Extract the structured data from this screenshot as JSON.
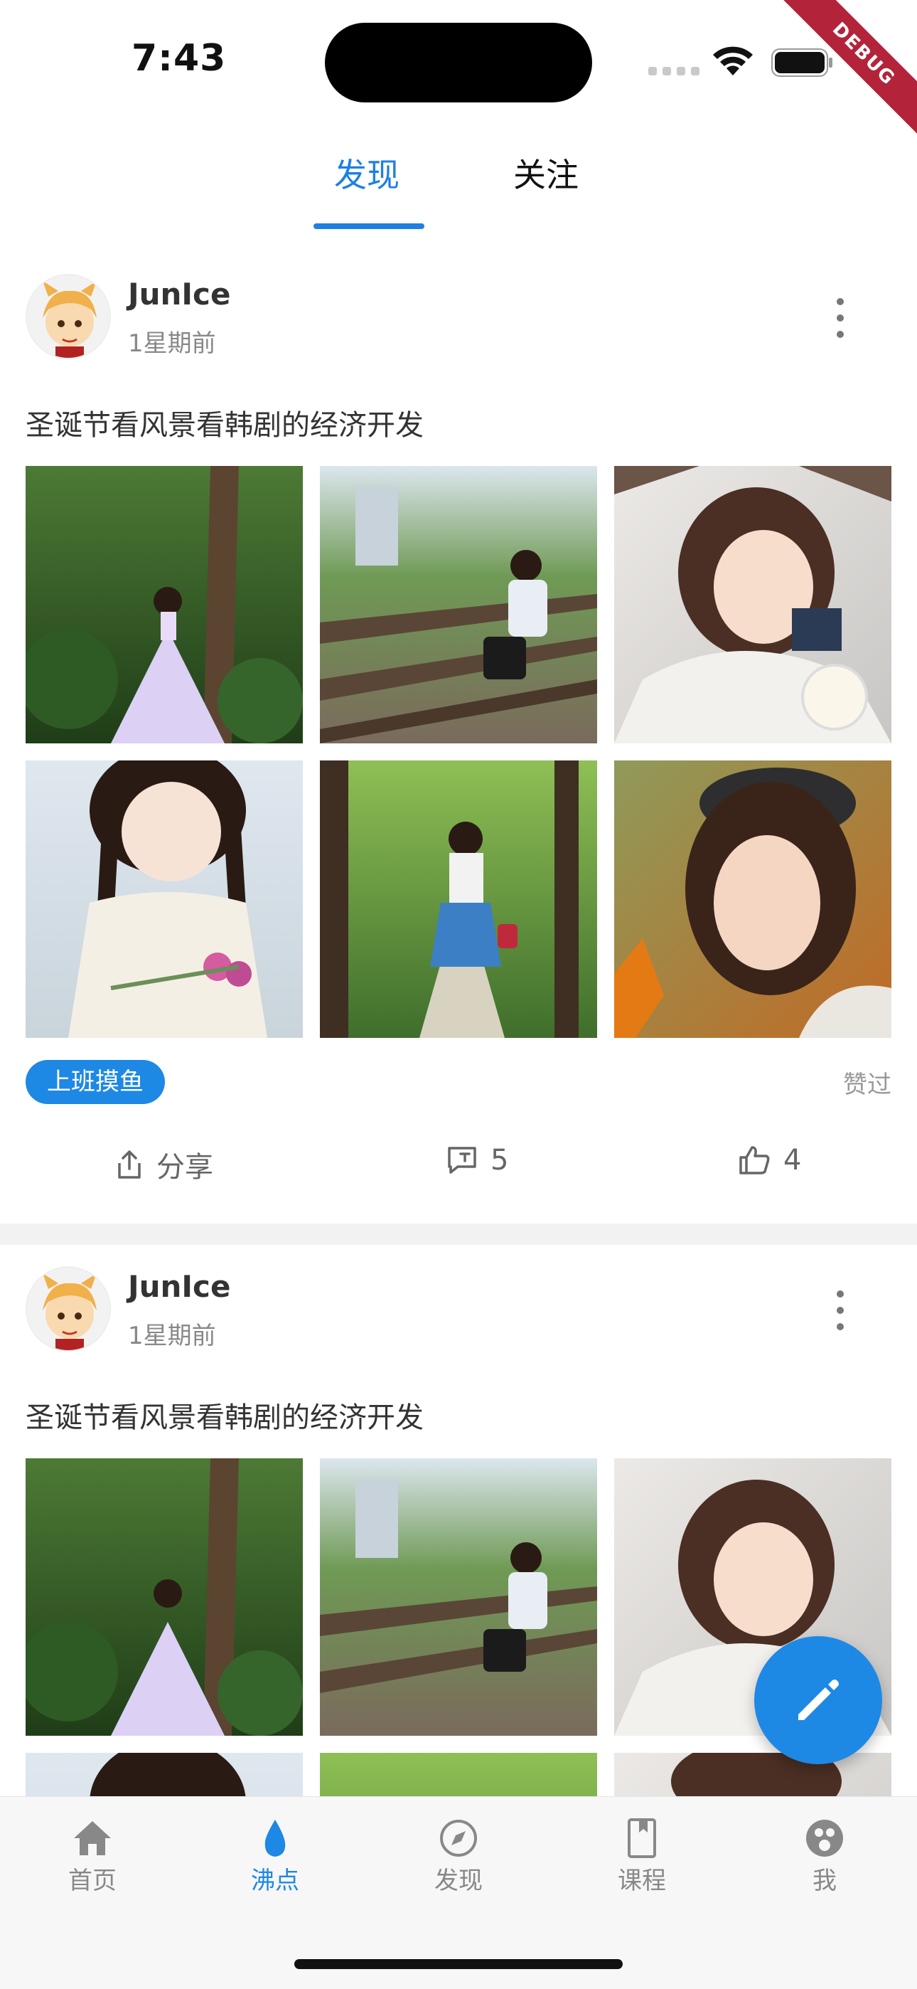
{
  "status_bar": {
    "time": "7:43",
    "debug_label": "DEBUG"
  },
  "top_tabs": [
    {
      "label": "发现",
      "active": true
    },
    {
      "label": "关注",
      "active": false
    }
  ],
  "posts": [
    {
      "author": "JunIce",
      "time": "1星期前",
      "content": "圣诞节看风景看韩剧的经济开发",
      "topic": "上班摸鱼",
      "liked_label": "赞过",
      "share_label": "分享",
      "comment_count": "5",
      "like_count": "4"
    },
    {
      "author": "JunIce",
      "time": "1星期前",
      "content": "圣诞节看风景看韩剧的经济开发"
    }
  ],
  "bottom_nav": [
    {
      "label": "首页",
      "icon": "home-icon",
      "active": false
    },
    {
      "label": "沸点",
      "icon": "flame-icon",
      "active": true
    },
    {
      "label": "发现",
      "icon": "compass-icon",
      "active": false
    },
    {
      "label": "课程",
      "icon": "book-icon",
      "active": false
    },
    {
      "label": "我",
      "icon": "profile-icon",
      "active": false
    }
  ],
  "colors": {
    "accent": "#1e88e5",
    "tab_accent": "#1e80e0",
    "divider": "#f2f2f2"
  }
}
